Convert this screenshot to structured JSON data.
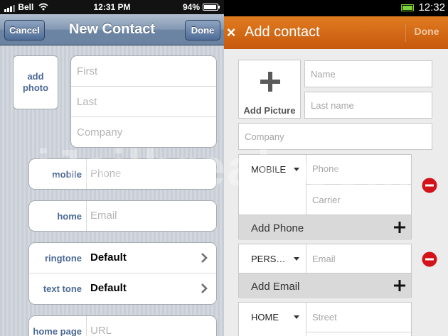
{
  "ios": {
    "status": {
      "carrier": "Bell",
      "time": "12:31 PM",
      "battery": "94%"
    },
    "nav": {
      "cancel": "Cancel",
      "title": "New Contact",
      "done": "Done"
    },
    "photo": {
      "line1": "add",
      "line2": "photo"
    },
    "name_fields": [
      "First",
      "Last",
      "Company"
    ],
    "phone_field": {
      "label": "mobile",
      "placeholder": "Phone"
    },
    "email_field": {
      "label": "home",
      "placeholder": "Email"
    },
    "tones": [
      {
        "label": "ringtone",
        "value": "Default"
      },
      {
        "label": "text tone",
        "value": "Default"
      }
    ],
    "url_field": {
      "label": "home page",
      "placeholder": "URL"
    }
  },
  "android": {
    "status": {
      "time": "12:32"
    },
    "bar": {
      "close": "×",
      "title": "Add contact",
      "done": "Done"
    },
    "picture": {
      "label": "Add Picture"
    },
    "name_placeholder": "Name",
    "lastname_placeholder": "Last name",
    "company_placeholder": "Company",
    "phone": {
      "type": "MOBILE",
      "placeholder": "Phone",
      "carrier_placeholder": "Carrier",
      "add_label": "Add Phone"
    },
    "email": {
      "type": "PERS…",
      "placeholder": "Email",
      "add_label": "Add Email"
    },
    "address": {
      "type": "HOME",
      "street_placeholder": "Street"
    }
  },
  "watermark": "iJailbreak.com",
  "colors": {
    "ios_nav": "#6d85a3",
    "ios_label": "#4c6996",
    "android_bar": "#d4670f",
    "android_remove": "#d3121a",
    "android_battery": "#7dd13a"
  },
  "icons": [
    "wifi-icon",
    "signal-icon",
    "battery-icon",
    "chevron-right-icon",
    "close-icon",
    "plus-icon",
    "remove-icon",
    "dropdown-icon"
  ]
}
